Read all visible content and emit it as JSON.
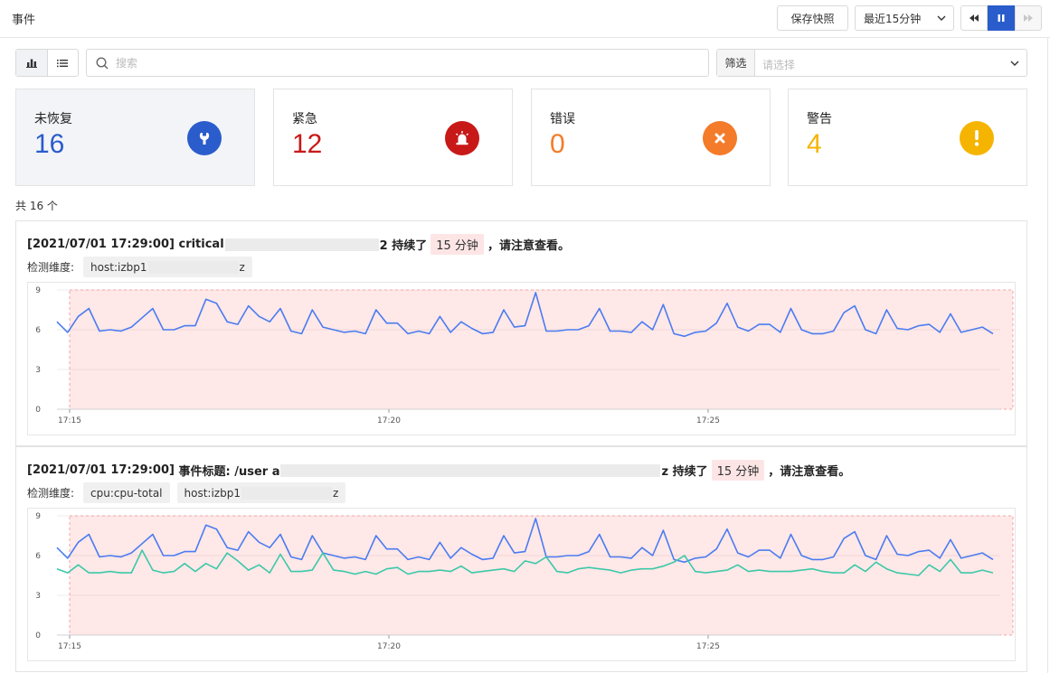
{
  "header": {
    "title": "事件",
    "snapshot_label": "保存快照",
    "time_range": "最近15分钟"
  },
  "toolbar": {
    "search_placeholder": "搜索",
    "filter_label": "筛选",
    "filter_placeholder": "请选择"
  },
  "stats": [
    {
      "label": "未恢复",
      "value": "16",
      "color": "#2a5ccc",
      "icon": "wrench-icon"
    },
    {
      "label": "紧急",
      "value": "12",
      "color": "#c81919",
      "icon": "alarm-icon"
    },
    {
      "label": "错误",
      "value": "0",
      "color": "#f47b29",
      "icon": "close-icon"
    },
    {
      "label": "警告",
      "value": "4",
      "color": "#f5b400",
      "icon": "exclamation-icon"
    }
  ],
  "total": "共 16 个",
  "events": [
    {
      "time": "[2021/07/01 17:29:00]",
      "prefix": "critical",
      "tail": "2 持续了",
      "duration": "15 分钟",
      "suffix": "，请注意查看。",
      "dim_label": "检测维度:",
      "tags": [
        "host:izbp1"
      ],
      "tag_tails": [
        "z"
      ]
    },
    {
      "time": "[2021/07/01 17:29:00]",
      "prefix": "事件标题: /user a",
      "tail": "z 持续了",
      "duration": "15 分钟",
      "suffix": "，请注意查看。",
      "dim_label": "检测维度:",
      "tags": [
        "cpu:cpu-total",
        "host:izbp1"
      ],
      "tag_tails": [
        "",
        "z"
      ]
    }
  ],
  "chart_data": [
    {
      "type": "line",
      "x_ticks": [
        "17:15",
        "17:20",
        "17:25"
      ],
      "y_ticks": [
        "0",
        "3",
        "6",
        "9"
      ],
      "ylim": [
        0,
        9
      ],
      "alert_region": true,
      "series": [
        {
          "color": "#4a7cf0",
          "values": [
            6.6,
            5.8,
            7.0,
            7.6,
            5.9,
            6.0,
            5.9,
            6.2,
            6.9,
            7.6,
            6.0,
            6.0,
            6.3,
            6.3,
            8.3,
            8.0,
            6.6,
            6.4,
            7.8,
            7.0,
            6.6,
            7.6,
            5.9,
            5.7,
            7.5,
            6.2,
            6.0,
            5.8,
            5.9,
            5.7,
            7.5,
            6.5,
            6.5,
            5.7,
            5.9,
            5.7,
            7.0,
            5.8,
            6.6,
            6.1,
            5.7,
            5.8,
            7.5,
            6.2,
            6.3,
            8.8,
            5.9,
            5.9,
            6.0,
            6.0,
            6.3,
            7.6,
            5.9,
            5.9,
            5.8,
            6.6,
            6.0,
            7.9,
            5.7,
            5.5,
            5.8,
            5.9,
            6.5,
            8.0,
            6.2,
            5.9,
            6.4,
            6.4,
            5.8,
            7.6,
            6.0,
            5.7,
            5.7,
            5.9,
            7.3,
            7.8,
            6.0,
            5.7,
            7.5,
            6.1,
            6.0,
            6.3,
            6.4,
            5.8,
            7.2,
            5.8,
            6.0,
            6.2,
            5.7
          ]
        }
      ]
    },
    {
      "type": "line",
      "x_ticks": [
        "17:15",
        "17:20",
        "17:25"
      ],
      "y_ticks": [
        "0",
        "3",
        "6",
        "9"
      ],
      "ylim": [
        0,
        9
      ],
      "alert_region": true,
      "series": [
        {
          "color": "#4a7cf0",
          "values": [
            6.6,
            5.8,
            7.0,
            7.6,
            5.9,
            6.0,
            5.9,
            6.2,
            6.9,
            7.6,
            6.0,
            6.0,
            6.3,
            6.3,
            8.3,
            8.0,
            6.6,
            6.4,
            7.8,
            7.0,
            6.6,
            7.6,
            5.9,
            5.7,
            7.5,
            6.2,
            6.0,
            5.8,
            5.9,
            5.7,
            7.5,
            6.5,
            6.5,
            5.7,
            5.9,
            5.7,
            7.0,
            5.8,
            6.6,
            6.1,
            5.7,
            5.8,
            7.5,
            6.2,
            6.3,
            8.8,
            5.9,
            5.9,
            6.0,
            6.0,
            6.3,
            7.6,
            5.9,
            5.9,
            5.8,
            6.6,
            6.0,
            7.9,
            5.7,
            5.5,
            5.8,
            5.9,
            6.5,
            8.0,
            6.2,
            5.9,
            6.4,
            6.4,
            5.8,
            7.6,
            6.0,
            5.7,
            5.7,
            5.9,
            7.3,
            7.8,
            6.0,
            5.7,
            7.5,
            6.1,
            6.0,
            6.3,
            6.4,
            5.8,
            7.2,
            5.8,
            6.0,
            6.2,
            5.7
          ]
        },
        {
          "color": "#3cc8a8",
          "values": [
            5.0,
            4.7,
            5.3,
            4.7,
            4.7,
            4.8,
            4.7,
            4.7,
            6.4,
            4.9,
            4.7,
            4.8,
            5.4,
            4.8,
            5.4,
            5.0,
            6.2,
            5.6,
            4.9,
            5.3,
            4.7,
            6.1,
            4.8,
            4.8,
            4.9,
            6.2,
            4.9,
            4.8,
            4.6,
            4.8,
            4.6,
            5.0,
            5.1,
            4.6,
            4.8,
            4.8,
            4.9,
            4.8,
            5.2,
            4.7,
            4.8,
            4.9,
            5.0,
            4.8,
            5.6,
            5.4,
            5.9,
            4.8,
            4.7,
            5.0,
            5.1,
            5.0,
            4.9,
            4.7,
            4.9,
            5.0,
            5.0,
            5.2,
            5.5,
            6.0,
            4.8,
            4.7,
            4.8,
            4.9,
            5.3,
            4.8,
            4.9,
            4.8,
            4.8,
            4.8,
            4.9,
            5.0,
            4.8,
            4.7,
            4.7,
            5.3,
            4.8,
            5.5,
            5.0,
            4.7,
            4.6,
            4.5,
            5.3,
            4.8,
            5.7,
            4.7,
            4.7,
            4.9,
            4.7
          ]
        }
      ]
    }
  ]
}
